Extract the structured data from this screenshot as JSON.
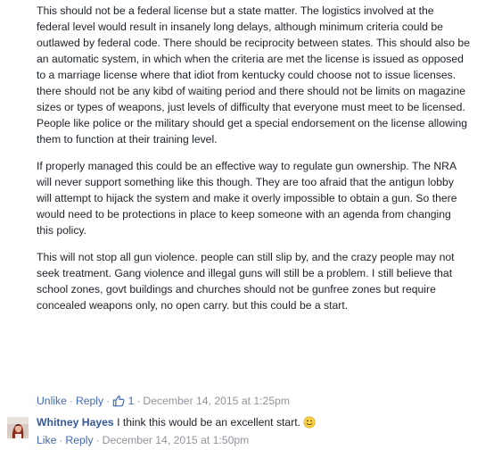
{
  "comment": {
    "paragraphs": [
      "This should not be a federal license but a state matter. The logistics involved at the federal level would result in insanely long delays, although minimum criteria could be outlawed by federal code. There should be reciprocity between states. This should also be an automatic system, in which when the criteria are met the license is issued as opposed to a marriage license where that idiot from kentucky could choose not to issue licenses. there should not be any kibd of waiting period and there should not be limits on magazine sizes or types of weapons, just levels of difficulty that everyone must meet to be licensed. People like police or the military should get a special endorsement on the license allowing them to function at their training level.",
      "If properly managed this could be an effective way to regulate gun ownership. The NRA will never support something like this though. They are too afraid that the antigun lobby will attempt to hijack the system and make it overly impossible to obtain a gun. So there would need to be protections in place to keep someone with an agenda from changing this policy.",
      "This will not stop all gun violence. people can still slip by, and the crazy people may not seek treatment. Gang violence and illegal guns will still be a problem. I still believe that school zones, govt buildings and churches should not be gunfree zones but require concealed weapons only, no open carry. but this could be a start."
    ],
    "meta": {
      "unlike_label": "Unlike",
      "reply_label": "Reply",
      "separator": "·",
      "like_count": "1",
      "date": "December 14, 2015 at 1:25pm"
    }
  },
  "reply": {
    "author": "Whitney Hayes",
    "text": "I think this would be an excellent start.",
    "meta": {
      "like_label": "Like",
      "reply_label": "Reply",
      "separator": "·",
      "date": "December 14, 2015 at 1:50pm"
    }
  },
  "colors": {
    "link": "#4267b2",
    "author": "#365899",
    "meta_gray": "#90949c",
    "text": "#1d2129"
  },
  "icons": {
    "like": "thumbs-up-icon",
    "emoji": "smiley-icon"
  }
}
